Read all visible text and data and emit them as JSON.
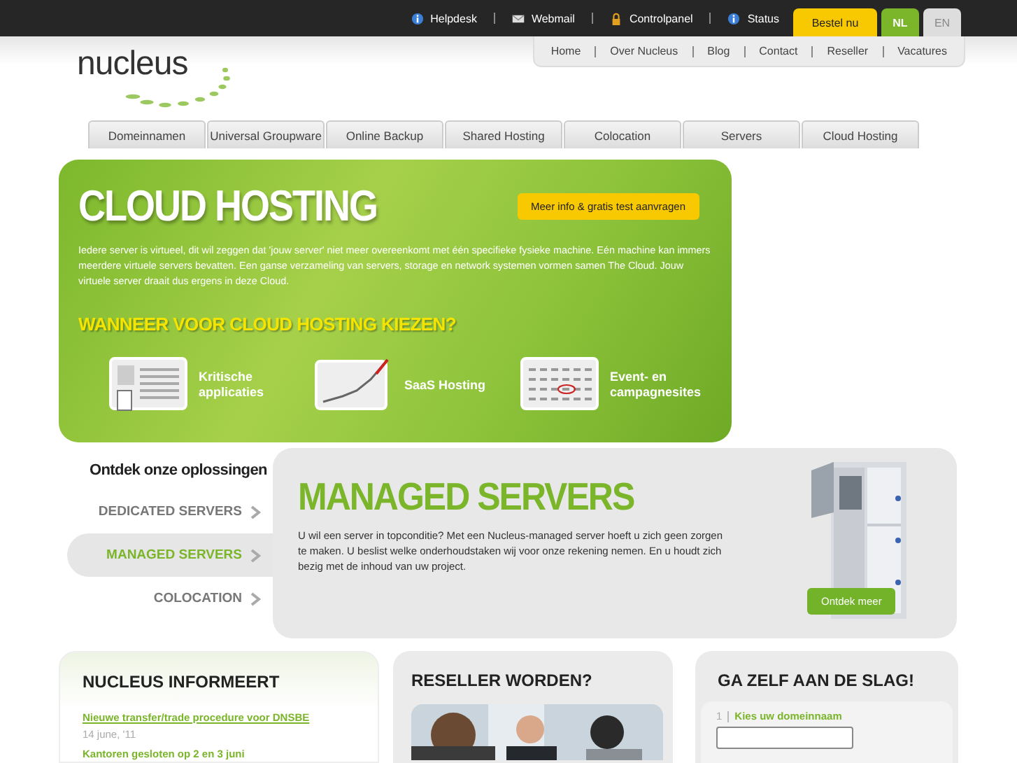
{
  "utility_links": [
    {
      "label": "Helpdesk",
      "kind": "info"
    },
    {
      "label": "Webmail",
      "kind": "mail"
    },
    {
      "label": "Controlpanel",
      "kind": "lock"
    },
    {
      "label": "Status",
      "kind": "info"
    }
  ],
  "order_button": "Bestel nu",
  "languages": [
    {
      "label": "NL",
      "selected": true
    },
    {
      "label": "EN",
      "selected": false
    }
  ],
  "top_nav": [
    "Home",
    "Over Nucleus",
    "Blog",
    "Contact",
    "Reseller",
    "Vacatures"
  ],
  "logo": "nucleus",
  "tabs": [
    "Domeinnamen",
    "Universal Groupware",
    "Online Backup",
    "Shared Hosting",
    "Colocation",
    "Servers",
    "Cloud Hosting"
  ],
  "banner": {
    "title": "CLOUD HOSTING",
    "button": "Meer info & gratis test aanvragen",
    "description": "Iedere server is virtueel, dit wil zeggen dat 'jouw server' niet meer overeenkomt met één specifieke fysieke machine. Eén machine kan immers meerdere virtuele servers bevatten. Een ganse verzameling van servers, storage en network systemen vormen samen The Cloud. Jouw virtuele server draait dus ergens in deze Cloud.",
    "subtitle": "WANNEER VOOR CLOUD HOSTING KIEZEN?",
    "features": [
      {
        "label": "Kritische applicaties",
        "kind": "card"
      },
      {
        "label": "SaaS Hosting",
        "kind": "chart"
      },
      {
        "label": "Event- en campagnesites",
        "kind": "calendar"
      }
    ]
  },
  "solutions": {
    "heading": "Ontdek onze oplossingen",
    "items": [
      {
        "label": "DEDICATED SERVERS",
        "selected": false
      },
      {
        "label": "MANAGED SERVERS",
        "selected": true
      },
      {
        "label": "COLOCATION",
        "selected": false
      }
    ]
  },
  "feature_panel": {
    "title": "MANAGED SERVERS",
    "text": "U wil een server in topconditie? Met een Nucleus-managed server hoeft u zich geen zorgen te maken. U beslist welke onderhoudstaken wij voor onze rekening nemen. En u houdt zich bezig met de inhoud van uw project.",
    "button": "Ontdek meer"
  },
  "news": {
    "title": "NUCLEUS INFORMEERT",
    "items": [
      {
        "title": "Nieuwe transfer/trade procedure voor DNSBE",
        "date": "14 june, '11"
      },
      {
        "title": "Kantoren gesloten op 2 en 3 juni"
      }
    ]
  },
  "reseller": {
    "title": "RESELLER WORDEN?"
  },
  "start": {
    "title": "GA ZELF AAN DE SLAG!",
    "step_number": "1",
    "step_label": "Kies uw domeinnaam"
  }
}
